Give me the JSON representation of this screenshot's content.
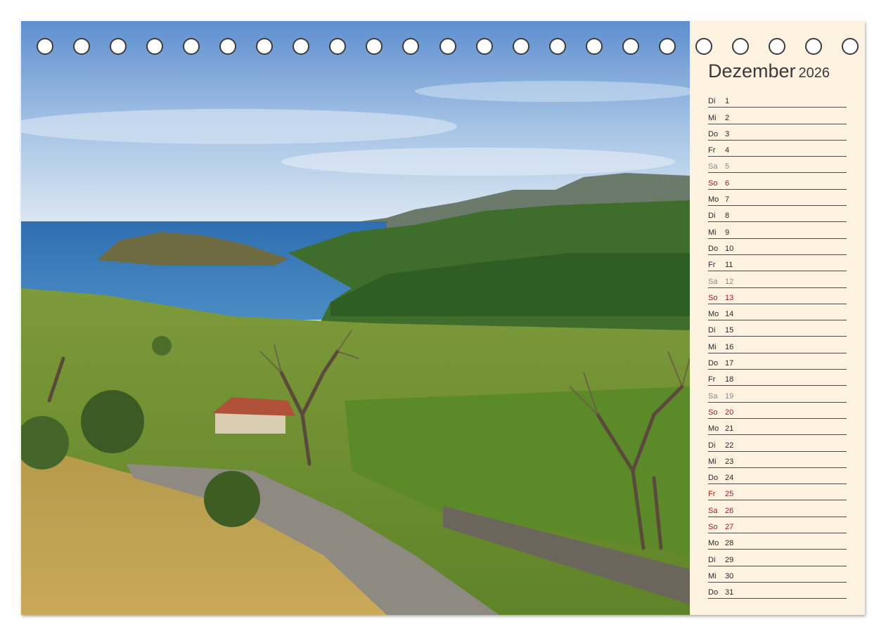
{
  "calendar": {
    "month": "Dezember",
    "year": "2026",
    "ring_count": 23,
    "colors": {
      "weekday": "#2a2a2a",
      "saturday": "#8a8a8a",
      "sunday_holiday": "#9a1c1c",
      "panel_background": "#fdf1e0"
    },
    "days": [
      {
        "wd": "Di",
        "d": "1",
        "kind": "weekday"
      },
      {
        "wd": "Mi",
        "d": "2",
        "kind": "weekday"
      },
      {
        "wd": "Do",
        "d": "3",
        "kind": "weekday"
      },
      {
        "wd": "Fr",
        "d": "4",
        "kind": "weekday"
      },
      {
        "wd": "Sa",
        "d": "5",
        "kind": "saturday"
      },
      {
        "wd": "So",
        "d": "6",
        "kind": "sunday"
      },
      {
        "wd": "Mo",
        "d": "7",
        "kind": "weekday"
      },
      {
        "wd": "Di",
        "d": "8",
        "kind": "weekday"
      },
      {
        "wd": "Mi",
        "d": "9",
        "kind": "weekday"
      },
      {
        "wd": "Do",
        "d": "10",
        "kind": "weekday"
      },
      {
        "wd": "Fr",
        "d": "11",
        "kind": "weekday"
      },
      {
        "wd": "Sa",
        "d": "12",
        "kind": "saturday"
      },
      {
        "wd": "So",
        "d": "13",
        "kind": "sunday"
      },
      {
        "wd": "Mo",
        "d": "14",
        "kind": "weekday"
      },
      {
        "wd": "Di",
        "d": "15",
        "kind": "weekday"
      },
      {
        "wd": "Mi",
        "d": "16",
        "kind": "weekday"
      },
      {
        "wd": "Do",
        "d": "17",
        "kind": "weekday"
      },
      {
        "wd": "Fr",
        "d": "18",
        "kind": "weekday"
      },
      {
        "wd": "Sa",
        "d": "19",
        "kind": "saturday"
      },
      {
        "wd": "So",
        "d": "20",
        "kind": "sunday"
      },
      {
        "wd": "Mo",
        "d": "21",
        "kind": "weekday"
      },
      {
        "wd": "Di",
        "d": "22",
        "kind": "weekday"
      },
      {
        "wd": "Mi",
        "d": "23",
        "kind": "weekday"
      },
      {
        "wd": "Do",
        "d": "24",
        "kind": "weekday"
      },
      {
        "wd": "Fr",
        "d": "25",
        "kind": "sunday"
      },
      {
        "wd": "Sa",
        "d": "26",
        "kind": "sunday"
      },
      {
        "wd": "So",
        "d": "27",
        "kind": "sunday"
      },
      {
        "wd": "Mo",
        "d": "28",
        "kind": "weekday"
      },
      {
        "wd": "Di",
        "d": "29",
        "kind": "weekday"
      },
      {
        "wd": "Mi",
        "d": "30",
        "kind": "weekday"
      },
      {
        "wd": "Do",
        "d": "31",
        "kind": "weekday"
      }
    ]
  }
}
